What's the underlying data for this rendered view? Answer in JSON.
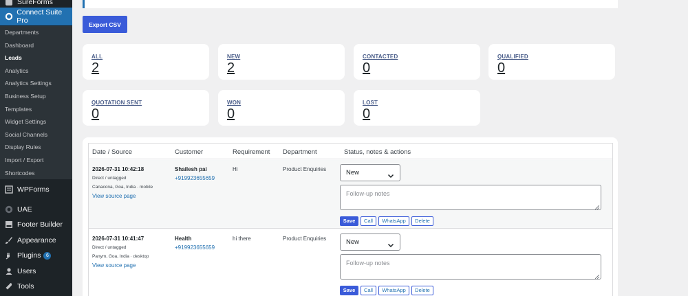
{
  "sidebar": {
    "top_items": [
      {
        "label": "SureForms",
        "icon": "sureforms-icon"
      },
      {
        "label": "Connect Suite Pro",
        "icon": "whatsapp-icon"
      }
    ],
    "sub_items": [
      "Departments",
      "Dashboard",
      "Leads",
      "Analytics",
      "Analytics Settings",
      "Business Setup",
      "Templates",
      "Widget Settings",
      "Social Channels",
      "Display Rules",
      "Import / Export",
      "Shortcodes"
    ],
    "bottom_items": [
      {
        "label": "WPForms",
        "icon": "wpforms-icon"
      },
      {
        "label": "UAE",
        "icon": "uae-icon"
      },
      {
        "label": "Footer Builder",
        "icon": "footer-builder-icon"
      },
      {
        "label": "Appearance",
        "icon": "paintbrush-icon"
      },
      {
        "label": "Plugins",
        "icon": "plugin-icon",
        "badge": "6"
      },
      {
        "label": "Users",
        "icon": "user-icon"
      },
      {
        "label": "Tools",
        "icon": "wrench-icon"
      }
    ]
  },
  "toolbar": {
    "export_label": "Export CSV"
  },
  "stats": [
    {
      "label": "ALL",
      "value": "2"
    },
    {
      "label": "NEW",
      "value": "2"
    },
    {
      "label": "CONTACTED",
      "value": "0"
    },
    {
      "label": "QUALIFIED",
      "value": "0"
    },
    {
      "label": "QUOTATION SENT",
      "value": "0"
    },
    {
      "label": "WON",
      "value": "0"
    },
    {
      "label": "LOST",
      "value": "0"
    }
  ],
  "table": {
    "headers": [
      "Date / Source",
      "Customer",
      "Requirement",
      "Department",
      "Status, notes & actions"
    ],
    "rows": [
      {
        "date": "2026-07-31 10:42:18",
        "source": "Direct / untagged",
        "location": "Canacona, Goa, India · mobile",
        "view_link": "View source page",
        "customer": "Shailesh pai",
        "phone": "+919923655659",
        "requirement": "Hi",
        "department": "Product Enquiries",
        "status": "New",
        "notes_placeholder": "Follow-up notes"
      },
      {
        "date": "2026-07-31 10:41:47",
        "source": "Direct / untagged",
        "location": "Panym, Goa, India · desktop",
        "view_link": "View source page",
        "customer": "Health",
        "phone": "+919923655659",
        "requirement": "hi there",
        "department": "Product Enquiries",
        "status": "New",
        "notes_placeholder": "Follow-up notes"
      }
    ],
    "actions": {
      "save": "Save",
      "call": "Call",
      "whatsapp": "WhatsApp",
      "delete": "Delete"
    }
  }
}
